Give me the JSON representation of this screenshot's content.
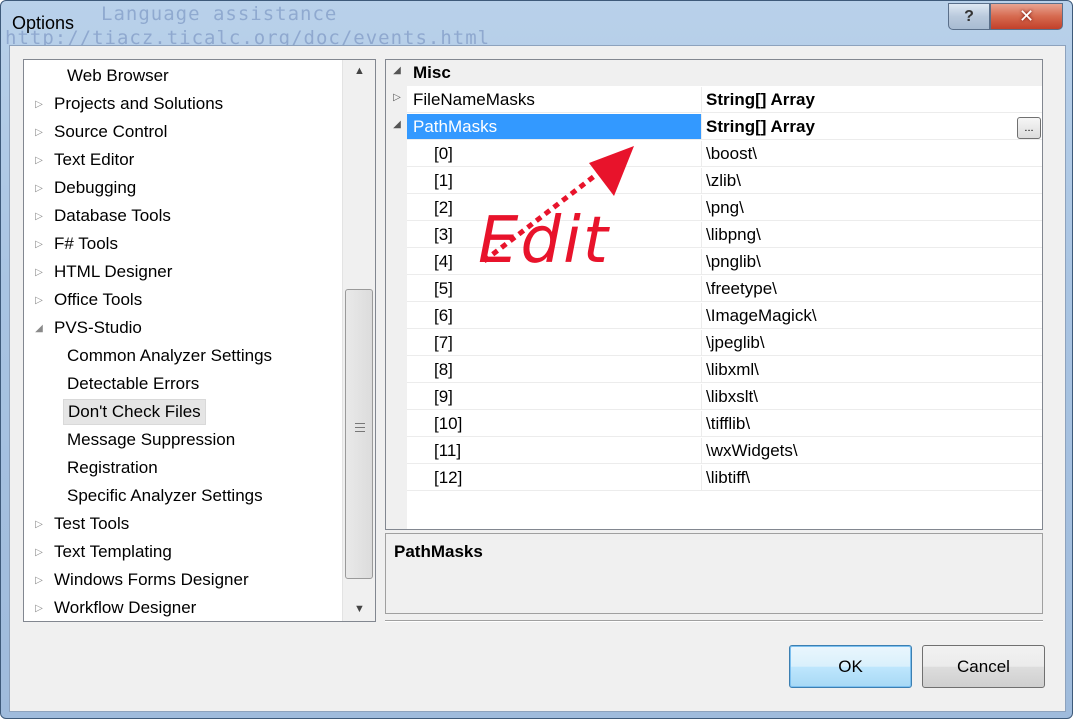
{
  "window": {
    "title": "Options",
    "help_glyph": "?",
    "close_glyph": "✕",
    "ghost_line1": "Language assistance",
    "ghost_line2": "http://tiacz.ticalc.org/doc/events.html"
  },
  "tree": {
    "items": [
      {
        "label": "Web Browser",
        "level": 1,
        "arrow": ""
      },
      {
        "label": "Projects and Solutions",
        "level": 0,
        "arrow": "▷"
      },
      {
        "label": "Source Control",
        "level": 0,
        "arrow": "▷"
      },
      {
        "label": "Text Editor",
        "level": 0,
        "arrow": "▷"
      },
      {
        "label": "Debugging",
        "level": 0,
        "arrow": "▷"
      },
      {
        "label": "Database Tools",
        "level": 0,
        "arrow": "▷"
      },
      {
        "label": "F# Tools",
        "level": 0,
        "arrow": "▷"
      },
      {
        "label": "HTML Designer",
        "level": 0,
        "arrow": "▷"
      },
      {
        "label": "Office Tools",
        "level": 0,
        "arrow": "▷"
      },
      {
        "label": "PVS-Studio",
        "level": 0,
        "arrow": "◢"
      },
      {
        "label": "Common Analyzer Settings",
        "level": 1,
        "arrow": ""
      },
      {
        "label": "Detectable Errors",
        "level": 1,
        "arrow": ""
      },
      {
        "label": "Don't Check Files",
        "level": 1,
        "arrow": "",
        "selected": true
      },
      {
        "label": "Message Suppression",
        "level": 1,
        "arrow": ""
      },
      {
        "label": "Registration",
        "level": 1,
        "arrow": ""
      },
      {
        "label": "Specific Analyzer Settings",
        "level": 1,
        "arrow": ""
      },
      {
        "label": "Test Tools",
        "level": 0,
        "arrow": "▷"
      },
      {
        "label": "Text Templating",
        "level": 0,
        "arrow": "▷"
      },
      {
        "label": "Windows Forms Designer",
        "level": 0,
        "arrow": "▷"
      },
      {
        "label": "Workflow Designer",
        "level": 0,
        "arrow": "▷"
      }
    ],
    "scroll_up": "▲",
    "scroll_down": "▼"
  },
  "grid": {
    "category": "Misc",
    "category_arrow": "◢",
    "properties": [
      {
        "name": "FileNameMasks",
        "value": "String[] Array",
        "arrow": "▷"
      },
      {
        "name": "PathMasks",
        "value": "String[] Array",
        "arrow": "◢",
        "selected": true
      }
    ],
    "ellipsis": "...",
    "children": [
      {
        "name": "[0]",
        "value": "\\boost\\"
      },
      {
        "name": "[1]",
        "value": "\\zlib\\"
      },
      {
        "name": "[2]",
        "value": "\\png\\"
      },
      {
        "name": "[3]",
        "value": "\\libpng\\"
      },
      {
        "name": "[4]",
        "value": "\\pnglib\\"
      },
      {
        "name": "[5]",
        "value": "\\freetype\\"
      },
      {
        "name": "[6]",
        "value": "\\ImageMagick\\"
      },
      {
        "name": "[7]",
        "value": "\\jpeglib\\"
      },
      {
        "name": "[8]",
        "value": "\\libxml\\"
      },
      {
        "name": "[9]",
        "value": "\\libxslt\\"
      },
      {
        "name": "[10]",
        "value": "\\tifflib\\"
      },
      {
        "name": "[11]",
        "value": "\\wxWidgets\\"
      },
      {
        "name": "[12]",
        "value": "\\libtiff\\"
      }
    ]
  },
  "annotation": {
    "text": "Edit",
    "color": "#e8132b"
  },
  "description": {
    "title": "PathMasks"
  },
  "buttons": {
    "ok": "OK",
    "cancel": "Cancel"
  },
  "colors": {
    "selection": "#3399ff",
    "accent_border": "#3c7fb1"
  }
}
